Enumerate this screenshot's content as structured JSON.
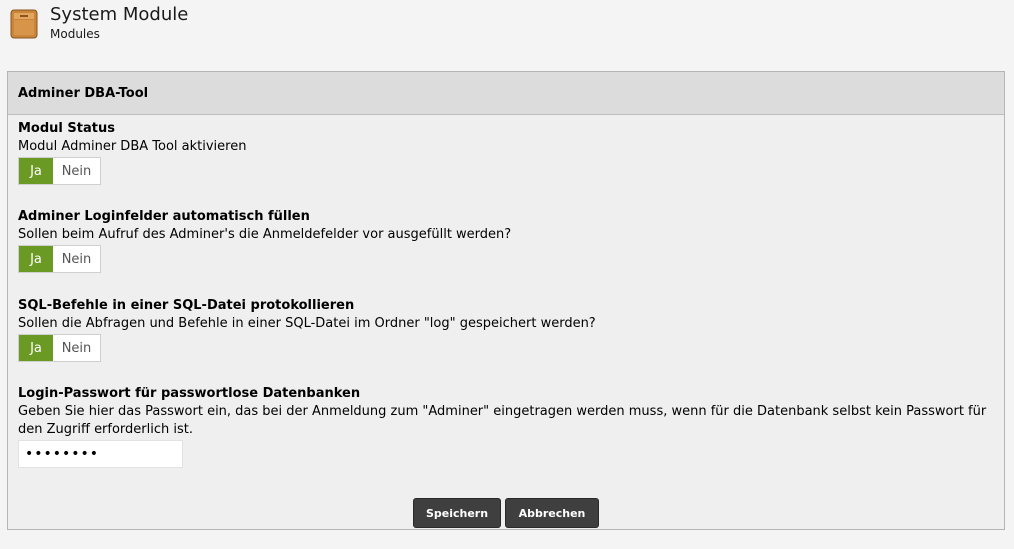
{
  "header": {
    "title": "System Module",
    "subtitle": "Modules",
    "icon": "module-box-icon"
  },
  "panel": {
    "title": "Adminer DBA-Tool"
  },
  "fields": {
    "status": {
      "title": "Modul Status",
      "description": "Modul Adminer DBA Tool aktivieren",
      "yes": "Ja",
      "no": "Nein",
      "selected": "Ja"
    },
    "autofill": {
      "title": "Adminer Loginfelder automatisch füllen",
      "description": "Sollen beim Aufruf des Adminer's die Anmeldefelder vor ausgefüllt werden?",
      "yes": "Ja",
      "no": "Nein",
      "selected": "Ja"
    },
    "sql_log": {
      "title": "SQL-Befehle in einer SQL-Datei protokollieren",
      "description": "Sollen die Abfragen und Befehle in einer SQL-Datei im Ordner \"log\" gespeichert werden?",
      "yes": "Ja",
      "no": "Nein",
      "selected": "Ja"
    },
    "password": {
      "title": "Login-Passwort für passwortlose Datenbanken",
      "description": "Geben Sie hier das Passwort ein, das bei der Anmeldung zum \"Adminer\" eingetragen werden muss, wenn für die Datenbank selbst kein Passwort für den Zugriff erforderlich ist.",
      "value": "••••••••"
    }
  },
  "buttons": {
    "save": "Speichern",
    "cancel": "Abbrechen"
  },
  "colors": {
    "toggle_active": "#6b9a24",
    "button_bg": "#3f3f3f",
    "panel_header_bg": "#dcdcdc"
  }
}
